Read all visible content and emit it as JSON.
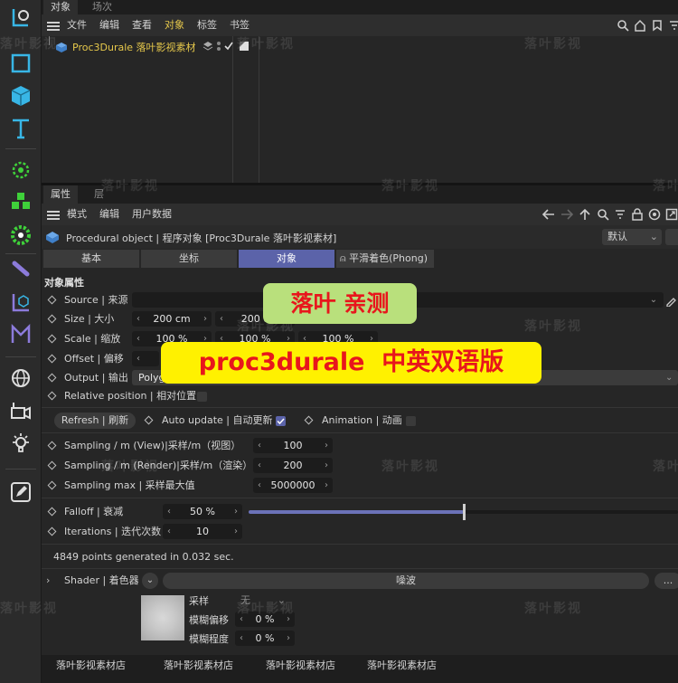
{
  "object_manager": {
    "tabs": [
      "对象",
      "场次"
    ],
    "menu": [
      "文件",
      "编辑",
      "查看",
      "对象",
      "标签",
      "书签"
    ],
    "object_row": {
      "name": "Proc3Durale 落叶影视素材"
    }
  },
  "attribute_manager": {
    "tabs": [
      "属性",
      "层"
    ],
    "menu": [
      "模式",
      "编辑",
      "用户数据"
    ],
    "header_title": "Procedural object | 程序对象 [Proc3Durale 落叶影视素材]",
    "header_mode": "默认",
    "mode_tabs": [
      "基本",
      "坐标",
      "对象",
      "平滑着色(Phong)"
    ],
    "active_mode_tab": "对象",
    "section_title": "对象属性",
    "source_label": "Source | 来源",
    "size_label": "Size | 大小",
    "size_values": [
      "200 cm",
      "200 c"
    ],
    "scale_label": "Scale | 缩放",
    "scale_values": [
      "100 %",
      "100 %",
      "100 %"
    ],
    "offset_label": "Offset | 偏移",
    "output_label": "Output | 输出",
    "output_value": "Polyg",
    "relpos_label": "Relative position | 相对位置",
    "refresh_label": "Refresh | 刷新",
    "autoupdate_label": "Auto update | 自动更新",
    "animation_label": "Animation | 动画",
    "sampling_view_label": "Sampling / m (View)|采样/m（视图）",
    "sampling_view_value": "100",
    "sampling_render_label": "Sampling / m (Render)|采样/m（渲染）",
    "sampling_render_value": "200",
    "sampling_max_label": "Sampling max | 采样最大值",
    "sampling_max_value": "5000000",
    "falloff_label": "Falloff | 衰减",
    "falloff_value": "50 %",
    "falloff_fraction": 0.5,
    "iterations_label": "Iterations | 迭代次数",
    "iterations_value": "10",
    "status_text": "4849 points generated in 0.032 sec.",
    "shader_label": "Shader | 着色器",
    "shader_value": "噪波",
    "shader_more": "...",
    "sample_label": "采样",
    "sample_value": "无",
    "blur_offset_label": "模糊偏移",
    "blur_offset_value": "0 %",
    "blur_degree_label": "模糊程度",
    "blur_degree_value": "0 %"
  },
  "overlays": {
    "green_text": "落叶 亲测",
    "yellow_text": "proc3durale  中英双语版",
    "watermark": "落叶影视"
  },
  "footer": [
    "落叶影视素材店",
    "落叶影视素材店",
    "落叶影视素材店",
    "落叶影视素材店"
  ],
  "colors": {
    "accent": "#5b63a9",
    "icon_blue": "#38b6e6",
    "icon_green": "#3fd13a",
    "green_overlay": "#b9e07c",
    "yellow_overlay": "#fff100",
    "overlay_text": "#e8161c"
  },
  "icons": [
    "null-object-icon",
    "cube-outline-icon",
    "cube-icon",
    "text-icon",
    "deformer-icon",
    "mograph-icon",
    "gear-flower-icon",
    "spline-icon",
    "axis-icon",
    "scene-icon",
    "globe-icon",
    "camera-icon",
    "light-icon",
    "edit-icon"
  ]
}
